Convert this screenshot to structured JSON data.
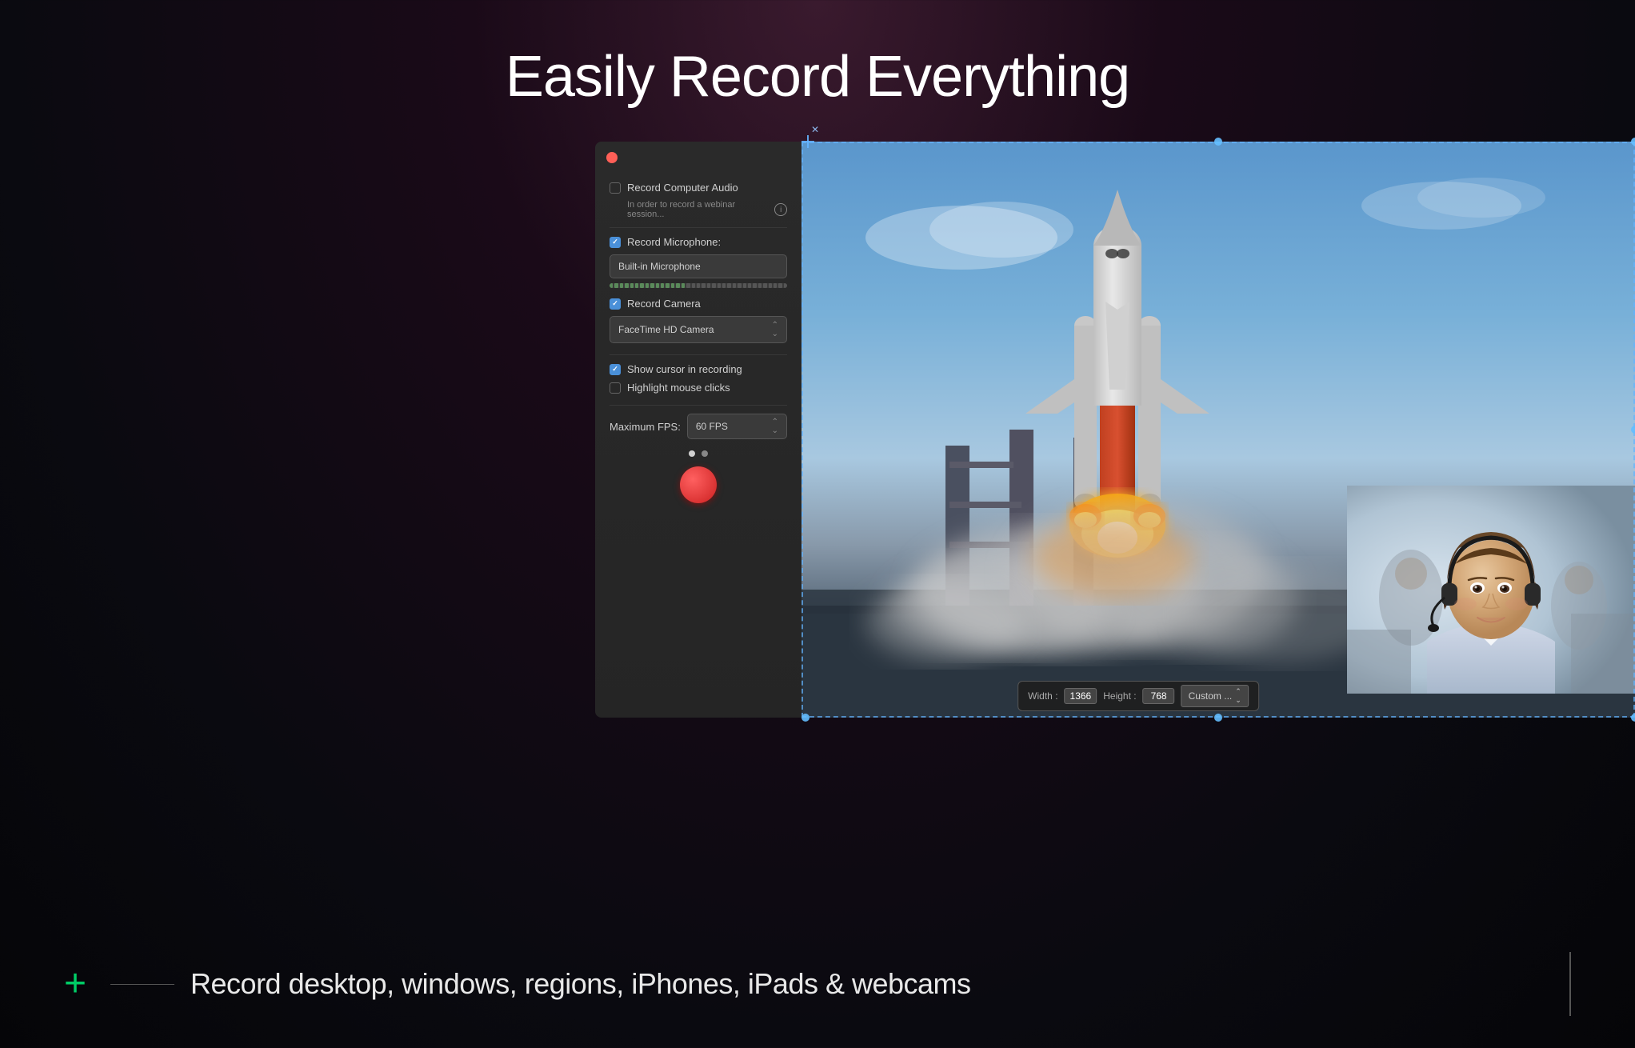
{
  "page": {
    "title": "Easily Record Everything",
    "bg_description": "dark purple-black gradient background"
  },
  "panel": {
    "record_computer_audio_label": "Record Computer Audio",
    "record_computer_audio_checked": false,
    "webinar_note": "In order to record a webinar session...",
    "record_microphone_label": "Record Microphone:",
    "record_microphone_checked": true,
    "microphone_value": "Built-in Microphone",
    "record_camera_label": "Record Camera",
    "record_camera_checked": true,
    "camera_value": "FaceTime HD Camera",
    "show_cursor_label": "Show cursor in recording",
    "show_cursor_checked": true,
    "highlight_mouse_label": "Highlight mouse clicks",
    "highlight_mouse_checked": false,
    "max_fps_label": "Maximum FPS:",
    "fps_value": "60 FPS"
  },
  "dimension_bar": {
    "width_label": "Width :",
    "width_value": "1366",
    "height_label": "Height :",
    "height_value": "768",
    "custom_label": "Custom ..."
  },
  "bottom": {
    "plus_symbol": "+",
    "description": "Record desktop, windows, regions, iPhones, iPads & webcams"
  },
  "volume_segments": 35,
  "volume_active_segments": 15,
  "dots": [
    {
      "active": true
    },
    {
      "active": false
    }
  ]
}
